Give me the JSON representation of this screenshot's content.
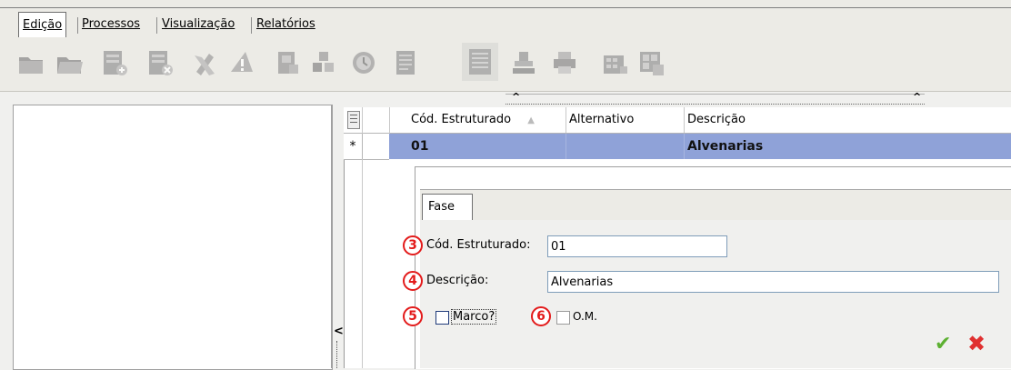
{
  "menu": {
    "tabs": [
      {
        "label": "Edição"
      },
      {
        "label": "Processos"
      },
      {
        "label": "Visualização"
      },
      {
        "label": "Relatórios"
      }
    ]
  },
  "toolbar": {
    "icons": [
      "folder-icon",
      "folder-open-icon",
      "add-record-icon",
      "delete-record-icon",
      "tools-icon",
      "warning-icon",
      "document-icon",
      "blocks-icon",
      "clock-icon",
      "report-icon",
      "list-icon",
      "stamp-icon",
      "print-icon",
      "calculator-icon",
      "grid-icon"
    ]
  },
  "grid": {
    "columns": [
      "Cód. Estruturado",
      "Alternativo",
      "Descrição"
    ],
    "sort_indicator": "▲",
    "row_marker": "*",
    "row": {
      "cod": "01",
      "alternativo": "",
      "descricao": "Alvenarias"
    },
    "row_color": "#8fa2d8"
  },
  "form": {
    "tab_label": "Fase",
    "cod_label": "Cód. Estruturado:",
    "cod_value": "01",
    "desc_label": "Descrição:",
    "desc_value": "Alvenarias",
    "marco_label": "Marco?",
    "om_label": "O.M.",
    "badges": [
      "3",
      "4",
      "5",
      "6"
    ],
    "ok_symbol": "✔",
    "cancel_symbol": "✖"
  },
  "splitter_symbol": "<"
}
